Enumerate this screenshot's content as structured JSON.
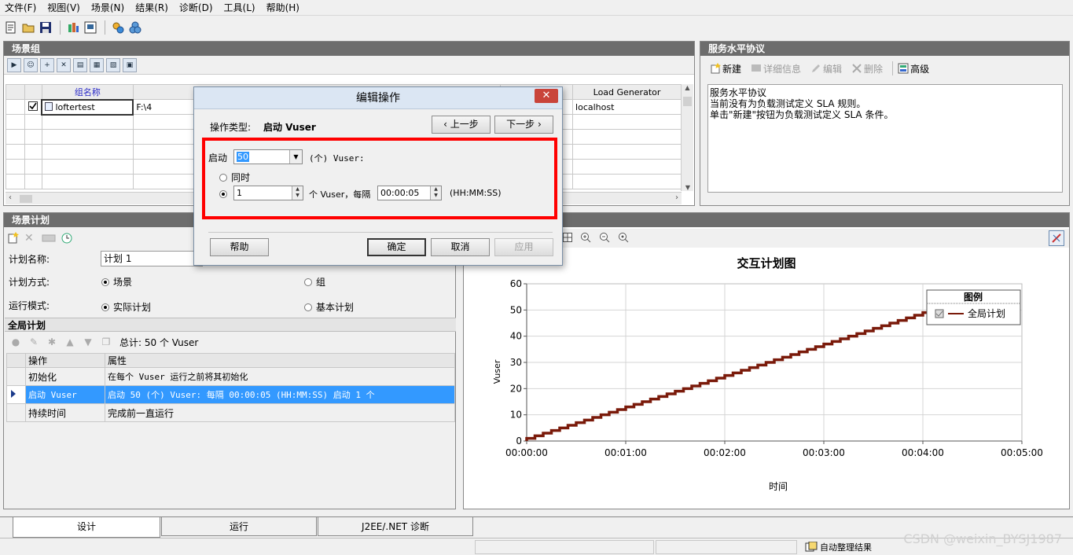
{
  "menu": [
    "文件(F)",
    "视图(V)",
    "场景(N)",
    "结果(R)",
    "诊断(D)",
    "工具(L)",
    "帮助(H)"
  ],
  "scenario_group": {
    "title": "场景组",
    "columns": {
      "group_name": "组名称",
      "load_generator": "Load Generator"
    },
    "rows": [
      {
        "checked": true,
        "name": "loftertest",
        "path": "F:\\4",
        "lg": "localhost"
      }
    ]
  },
  "sla": {
    "title": "服务水平协议",
    "toolbar": {
      "new": "新建",
      "details": "详细信息",
      "edit": "编辑",
      "delete": "删除",
      "advanced": "高级"
    },
    "text": {
      "line1": "服务水平协议",
      "line2": "当前没有为负载测试定义 SLA 规则。",
      "line3": "单击\"新建\"按钮为负载测试定义 SLA 条件。"
    }
  },
  "plan": {
    "title": "场景计划",
    "name_label": "计划名称:",
    "name_value": "计划 1",
    "mode_label": "计划方式:",
    "mode_scene": "场景",
    "mode_group": "组",
    "run_label": "运行模式:",
    "run_real": "实际计划",
    "run_basic": "基本计划",
    "global_title": "全局计划",
    "total": "总计: 50 个 Vuser",
    "table_head": {
      "action": "操作",
      "property": "属性"
    },
    "actions": [
      {
        "action": "初始化",
        "property": "在每个 Vuser 运行之前将其初始化",
        "selected": false
      },
      {
        "action": "启动 Vuser",
        "property": "启动 50 (个) Vuser: 每隔 00:00:05 (HH:MM:SS) 启动 1 个",
        "selected": true
      },
      {
        "action": "持续时间",
        "property": "完成前一直运行",
        "selected": false
      }
    ]
  },
  "dialog": {
    "title": "编辑操作",
    "close": "✕",
    "op_type_label": "操作类型:",
    "op_type_value": "启动 Vuser",
    "prev": "上一步",
    "next": "下一步",
    "start_label": "启动",
    "start_count": "50",
    "unit_label": "(个) Vuser:",
    "simultaneous": "同时",
    "per_count": "1",
    "per_text": "个 Vuser，每隔",
    "interval": "00:00:05",
    "interval_fmt": "(HH:MM:SS)",
    "help": "帮助",
    "ok": "确定",
    "cancel": "取消",
    "apply": "应用"
  },
  "chart_data": {
    "type": "line",
    "title": "交互计划图",
    "xlabel": "时间",
    "ylabel": "Vuser",
    "x_ticks": [
      "00:00:00",
      "00:01:00",
      "00:02:00",
      "00:03:00",
      "00:04:00",
      "00:05:00"
    ],
    "y_ticks": [
      0,
      10,
      20,
      30,
      40,
      50,
      60
    ],
    "xlim_seconds": [
      0,
      300
    ],
    "ylim": [
      0,
      60
    ],
    "legend_title": "图例",
    "legend_placement": "top-right",
    "series": [
      {
        "name": "全局计划",
        "color": "#7a1a0a",
        "start_vusers": 50,
        "step_vusers": 1,
        "step_interval_s": 5
      }
    ]
  },
  "tabs": [
    "设计",
    "运行",
    "J2EE/.NET 诊断"
  ],
  "status": {
    "auto_collate": "自动整理结果"
  },
  "watermark": "CSDN @weixin_BYSJ1987"
}
